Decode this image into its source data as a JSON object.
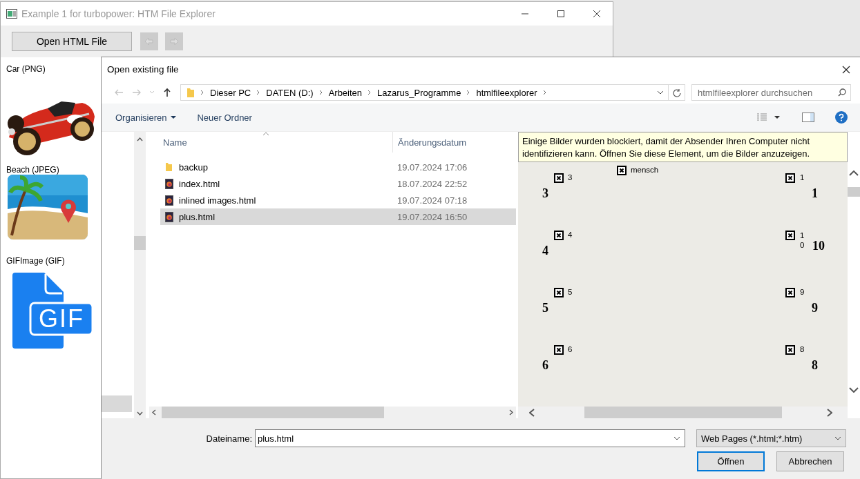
{
  "app_window": {
    "title": "Example 1 for turbopower: HTM File Explorer",
    "toolbar": [
      {
        "kind": "text",
        "label": "Open HTML File",
        "disabled": false
      },
      {
        "kind": "back",
        "disabled": true
      },
      {
        "kind": "forward",
        "disabled": true
      }
    ],
    "images": [
      {
        "caption": "Car (PNG)",
        "kind": "car"
      },
      {
        "caption": "Beach (JPEG)",
        "kind": "beach"
      },
      {
        "caption": "GIFImage (GIF)",
        "kind": "gif",
        "badge": "GIF"
      }
    ]
  },
  "dialog": {
    "title": "Open existing file",
    "nav": [
      {
        "kind": "back",
        "disabled": true
      },
      {
        "kind": "forward",
        "disabled": true
      },
      {
        "kind": "recent",
        "disabled": true
      },
      {
        "kind": "up",
        "disabled": false
      }
    ],
    "breadcrumb": [
      "Dieser PC",
      "DATEN (D:)",
      "Arbeiten",
      "Lazarus_Programme",
      "htmlfileexplorer"
    ],
    "search": {
      "placeholder": "htmlfileexplorer durchsuchen"
    },
    "commands": [
      {
        "label": "Organisieren",
        "dropdown": true
      },
      {
        "label": "Neuer Ordner",
        "dropdown": false
      }
    ],
    "columns": [
      "Name",
      "Änderungsdatum"
    ],
    "files": [
      {
        "name": "backup",
        "date": "19.07.2024 17:06",
        "kind": "folder",
        "selected": false
      },
      {
        "name": "index.html",
        "date": "18.07.2024 22:52",
        "kind": "html",
        "selected": false
      },
      {
        "name": "inlined images.html",
        "date": "19.07.2024 07:18",
        "kind": "html",
        "selected": false
      },
      {
        "name": "plus.html",
        "date": "19.07.2024 16:50",
        "kind": "html",
        "selected": true
      }
    ],
    "preview": {
      "notice": "Einige Bilder wurden blockiert, damit der Absender Ihren Computer nicht identifizieren kann. Öffnen Sie diese Element, um die Bilder anzuzeigen.",
      "center": {
        "alt": "mensch"
      },
      "left": [
        {
          "alt": "3",
          "number": "3"
        },
        {
          "alt": "4",
          "number": "4"
        },
        {
          "alt": "5",
          "number": "5"
        },
        {
          "alt": "6",
          "number": "6"
        }
      ],
      "right": [
        {
          "alt": "1",
          "number": "1"
        },
        {
          "alt": "10",
          "number": "10"
        },
        {
          "alt": "9",
          "number": "9"
        },
        {
          "alt": "8",
          "number": "8"
        }
      ]
    },
    "filename_label": "Dateiname:",
    "filename": "plus.html",
    "filter": "Web Pages (*.html;*.htm)",
    "buttons": [
      {
        "label": "Öffnen",
        "default": true
      },
      {
        "label": "Abbrechen",
        "default": false
      }
    ]
  }
}
